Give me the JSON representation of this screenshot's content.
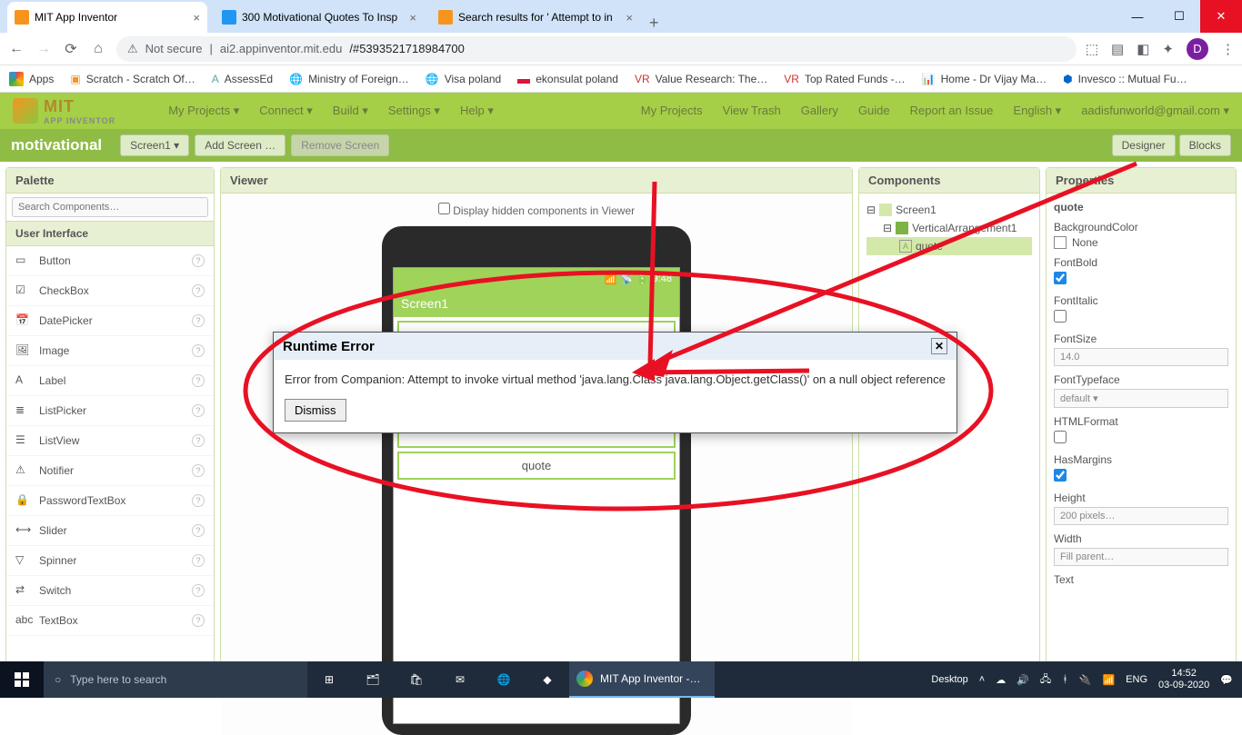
{
  "browser": {
    "tabs": [
      {
        "title": "MIT App Inventor",
        "active": true
      },
      {
        "title": "300 Motivational Quotes To Insp",
        "active": false
      },
      {
        "title": "Search results for ' Attempt to in",
        "active": false
      }
    ],
    "not_secure": "Not secure",
    "url_host": "ai2.appinventor.mit.edu",
    "url_path": "/#5393521718984700",
    "avatar": "D"
  },
  "bookmarks": [
    "Apps",
    "Scratch - Scratch Of…",
    "AssessEd",
    "Ministry of Foreign…",
    "Visa poland",
    "ekonsulat poland",
    "Value Research: The…",
    "Top Rated Funds -…",
    "Home - Dr Vijay Ma…",
    "Invesco :: Mutual Fu…"
  ],
  "ai_header": {
    "brand_top": "MIT",
    "brand_sub": "APP INVENTOR",
    "menu_left": [
      "My Projects ▾",
      "Connect ▾",
      "Build ▾",
      "Settings ▾",
      "Help ▾"
    ],
    "menu_right": [
      "My Projects",
      "View Trash",
      "Gallery",
      "Guide",
      "Report an Issue",
      "English ▾",
      "aadisfunworld@gmail.com ▾"
    ]
  },
  "greenbar": {
    "project": "motivational",
    "screen_btn": "Screen1 ▾",
    "add": "Add Screen …",
    "remove": "Remove Screen",
    "designer": "Designer",
    "blocks": "Blocks"
  },
  "palette": {
    "title": "Palette",
    "search_placeholder": "Search Components…",
    "category": "User Interface",
    "items": [
      "Button",
      "CheckBox",
      "DatePicker",
      "Image",
      "Label",
      "ListPicker",
      "ListView",
      "Notifier",
      "PasswordTextBox",
      "Slider",
      "Spinner",
      "Switch",
      "TextBox"
    ]
  },
  "viewer": {
    "title": "Viewer",
    "hide_label": "Display hidden components in Viewer",
    "time": "9:48",
    "screen": "Screen1",
    "quote": "quote"
  },
  "components": {
    "title": "Components",
    "root": "Screen1",
    "child1": "VerticalArrangement1",
    "child2": "quote"
  },
  "properties": {
    "title": "Properties",
    "component": "quote",
    "labels": {
      "bg": "BackgroundColor",
      "none": "None",
      "fb": "FontBold",
      "fi": "FontItalic",
      "fs": "FontSize",
      "ft": "FontTypeface",
      "hf": "HTMLFormat",
      "hm": "HasMargins",
      "h": "Height",
      "w": "Width",
      "txt": "Text"
    },
    "values": {
      "fs": "14.0",
      "ft": "default ▾",
      "h": "200 pixels…",
      "w": "Fill parent…"
    }
  },
  "dialog": {
    "title": "Runtime Error",
    "body": "Error from Companion: Attempt to invoke virtual method 'java.lang.Class java.lang.Object.getClass()' on a null object reference",
    "dismiss": "Dismiss"
  },
  "taskbar": {
    "search": "Type here to search",
    "app": "MIT App Inventor -…",
    "desktop": "Desktop",
    "lang": "ENG",
    "time": "14:52",
    "date": "03-09-2020"
  }
}
